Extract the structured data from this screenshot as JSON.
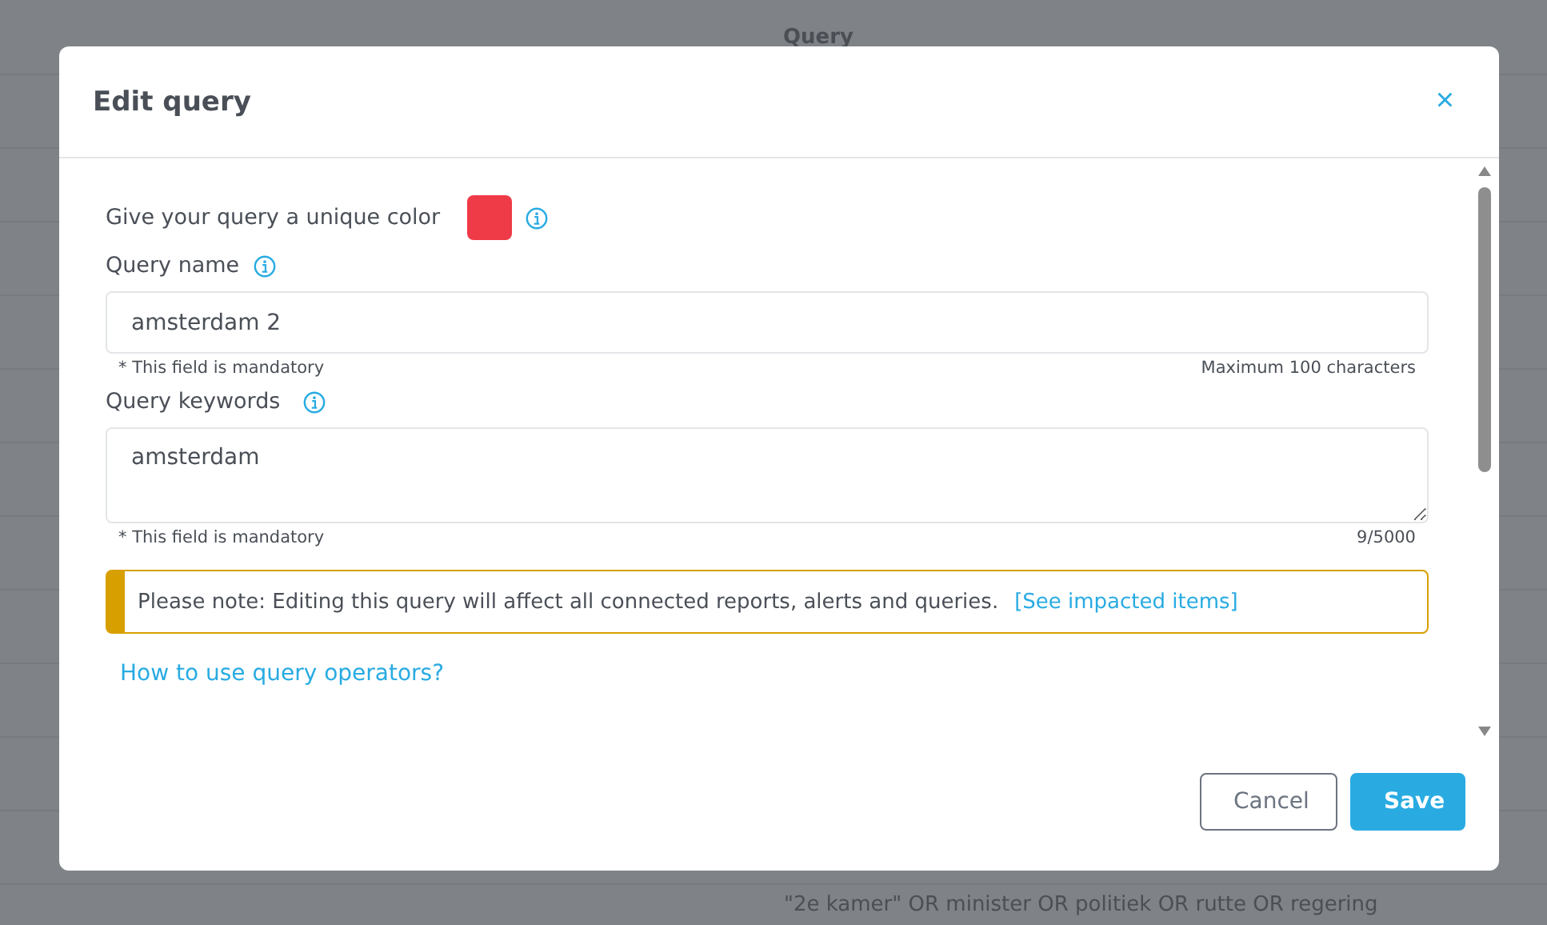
{
  "background": {
    "column_header": "Query",
    "row_text": "\"2e kamer\" OR minister OR politiek OR rutte OR regering"
  },
  "dialog": {
    "title": "Edit query",
    "close": "×",
    "color_label": "Give your query a unique color",
    "color": "#ef3a47",
    "name_field": {
      "label": "Query name",
      "value": "amsterdam 2",
      "hint": "* This field is mandatory",
      "limit": "Maximum 100 characters"
    },
    "keywords_field": {
      "label": "Query keywords",
      "value": "amsterdam",
      "hint": "* This field is mandatory",
      "count": "9/5000"
    },
    "notice": {
      "text": "Please note: Editing this query will affect all connected reports, alerts and queries.",
      "link": "[See impacted items]"
    },
    "help_link": "How to use query operators?",
    "buttons": [
      {
        "label": "Cancel",
        "kind": "secondary"
      },
      {
        "label": "Save",
        "kind": "primary"
      }
    ]
  }
}
